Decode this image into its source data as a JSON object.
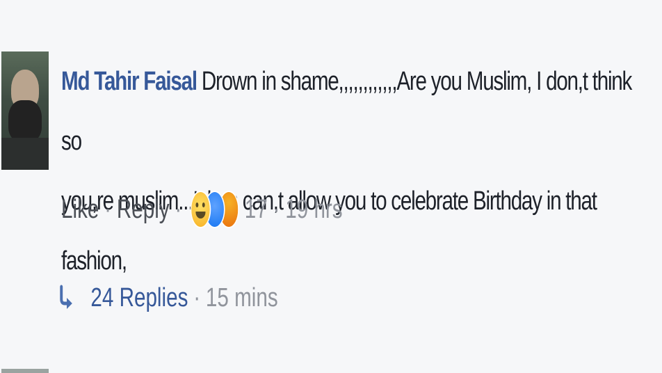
{
  "comment": {
    "author": "Md Tahir Faisal",
    "text_line1": "Drown in shame,,,,,,,,,,,,Are you Muslim, I don,t think so",
    "text_line2": "you,re muslim...Islam can,t allow you to celebrate Birthday in that fashion,",
    "actions": {
      "like_label": "Like",
      "reply_label": "Reply",
      "separator": "·",
      "reaction_count": "17",
      "timestamp": "19 hrs"
    },
    "reactions": [
      "haha-icon",
      "wow-icon",
      "angry-icon"
    ]
  },
  "replies": {
    "count_label": "24 Replies",
    "separator": "·",
    "timestamp": "15 mins",
    "icon": "reply-arrow-icon"
  },
  "colors": {
    "background": "#f6f7f9",
    "author": "#365899",
    "text": "#1d2129",
    "muted": "#90949c",
    "link": "#4b4f56"
  }
}
